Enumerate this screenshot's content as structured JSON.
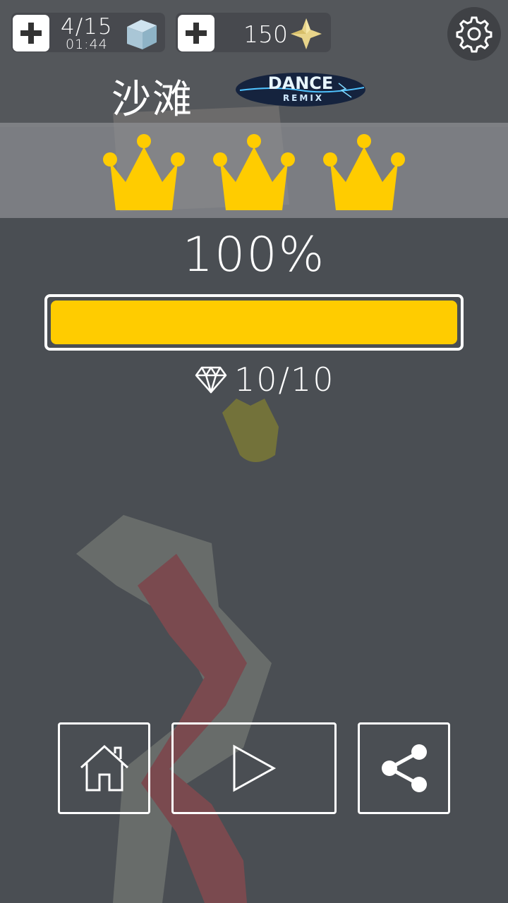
{
  "hud": {
    "lives": "4/15",
    "lives_timer": "01:44",
    "gems": "150"
  },
  "level": {
    "name": "沙滩",
    "mode_logo_word1": "DANCE",
    "mode_logo_word2": "REMIX"
  },
  "result": {
    "crowns_earned": 3,
    "crowns_total": 3,
    "percent_text": "100%",
    "progress_fraction": 1.0,
    "gems_collected": "10/10"
  },
  "colors": {
    "accent_yellow": "#ffcc00",
    "background": "#4a4e53"
  },
  "icons": [
    "plus-icon",
    "ice-cube-icon",
    "gem-star-icon",
    "gear-icon",
    "diamond-icon",
    "home-icon",
    "play-icon",
    "share-icon"
  ]
}
